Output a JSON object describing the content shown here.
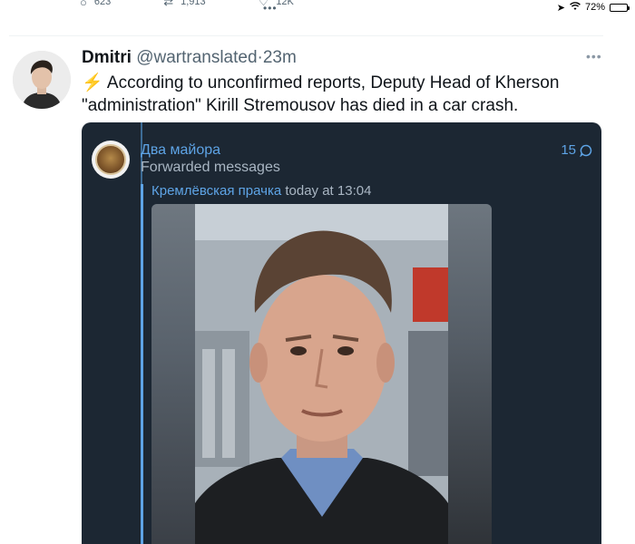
{
  "status": {
    "battery": "72%",
    "battery_level": 0.72
  },
  "previous_tweet": {
    "reply_count": "623",
    "retweet_count": "1,913",
    "like_count": "12K",
    "reply_icon": "reply-icon",
    "retweet_icon": "retweet-icon",
    "like_icon": "like-icon",
    "share_icon": "share-icon"
  },
  "tweet": {
    "display_name": "Dmitri",
    "handle": "@wartranslated",
    "separator": "·",
    "time": "23m",
    "bolt": "⚡",
    "text": " According to unconfirmed reports, Deputy Head of Kherson \"administration\" Kirill Stremousov has died in a car crash.",
    "more_icon": "more-icon"
  },
  "telegram": {
    "channel_name": "Два майора",
    "forwarded_label": "Forwarded messages",
    "views": "15",
    "forward_author": "Кремлёвская прачка",
    "forward_time": " today at 13:04"
  }
}
